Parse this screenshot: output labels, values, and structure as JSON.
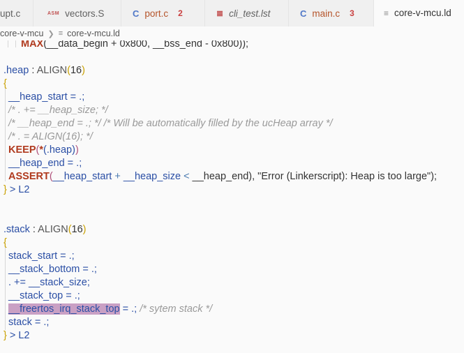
{
  "tabs": [
    {
      "icon": "",
      "label": "upt.c",
      "count": ""
    },
    {
      "icon": "ASM",
      "label": "vectors.S",
      "count": ""
    },
    {
      "icon": "C",
      "label": "port.c",
      "count": "2"
    },
    {
      "icon": "≣",
      "label": "cli_test.lst",
      "count": ""
    },
    {
      "icon": "C",
      "label": "main.c",
      "count": "3"
    },
    {
      "icon": "≡",
      "label": "core-v-mcu.ld",
      "count": ""
    }
  ],
  "breadcrumb": {
    "folder": "core-v-mcu",
    "file": "core-v-mcu.ld"
  },
  "code": {
    "l0": {
      "kw": "MAX",
      "rest": "(__data_begin + 0x800, __bss_end - 0x800));"
    },
    "l2": {
      "name": ".heap",
      "colon": " : ",
      "kw": "ALIGN",
      "open": "(",
      "num": "16",
      "close": ")"
    },
    "l3": "{",
    "l4": "__heap_start = .;",
    "l5": "/* . += __heap_size; */",
    "l6": "/* __heap_end = .; */ /* Will be automatically filled by the ucHeap array */",
    "l7": "/* . = ALIGN(16); */",
    "l8": {
      "kw": "KEEP",
      "open": "(",
      "star": "*",
      "inner": "(.heap)",
      "close": ")"
    },
    "l9": "__heap_end = .;",
    "l10": {
      "kw": "ASSERT",
      "open": "(",
      "a": "__heap_start",
      "plus": " + ",
      "b": "__heap_size",
      "lt": " < ",
      "c": "__heap_end), \"Error ",
      "p": "(Linkerscript)",
      "msg": ": Heap is too large\"",
      "close": ");"
    },
    "l11": {
      "brace": "}",
      "rest": " > L2"
    },
    "l14": {
      "name": ".stack",
      "colon": " : ",
      "kw": "ALIGN",
      "open": "(",
      "num": "16",
      "close": ")"
    },
    "l15": "{",
    "l16": "stack_start = .;",
    "l17": "__stack_bottom = .;",
    "l18": ". += __stack_size;",
    "l19": "__stack_top = .;",
    "l20": {
      "sel": "__freertos_irq_stack_top",
      "rest": " = .; ",
      "cmt": "/* sytem stack */"
    },
    "l21": "stack = .;",
    "l22": {
      "brace": "}",
      "rest": " > L2"
    }
  }
}
